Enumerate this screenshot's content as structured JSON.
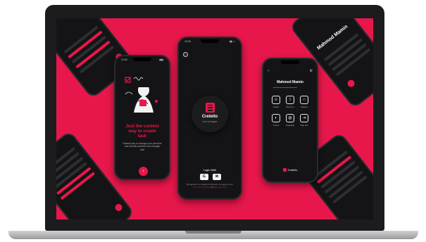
{
  "colors": {
    "accent": "#e8174b",
    "panel": "#141416",
    "background": "#e8174b"
  },
  "onboarding": {
    "time": "13:40",
    "title_line1": "Just the coolest",
    "title_line2": "way to create",
    "title_line3": "task",
    "description": "Easiest way to manage your personal and internal workflow and manage task",
    "next_icon": "arrow-right-icon"
  },
  "splash": {
    "time": "13:33",
    "app_name": "Cretello",
    "tagline": "Line to Inspire",
    "login_label": "Login With",
    "google_label": "G",
    "email_icon": "mail-icon",
    "terms_text": "By signing in or creating an account, you agree to our",
    "terms_link": "Terms & Conditions",
    "and_text": "and",
    "privacy_link": "Privacy Policy"
  },
  "profile": {
    "name": "Mahmod Mamin",
    "items": [
      {
        "label": "Profile",
        "icon": "user-icon"
      },
      {
        "label": "About us",
        "icon": "info-icon"
      },
      {
        "label": "Support",
        "icon": "headset-icon"
      },
      {
        "label": "Theme",
        "icon": "palette-icon"
      },
      {
        "label": "Language",
        "icon": "globe-icon"
      },
      {
        "label": "Sign Out",
        "icon": "logout-icon"
      }
    ],
    "brand": "Cretello"
  },
  "corner_phone_top_right": {
    "title": "Mahmod Mamin"
  }
}
